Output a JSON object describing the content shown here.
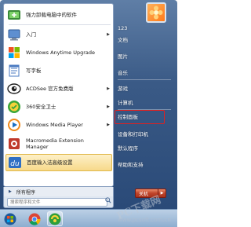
{
  "left_panel": {
    "items": [
      {
        "label": "强力卸载电脑中的软件",
        "icon": "uninstall-icon",
        "arrow": false
      },
      {
        "label": "入门",
        "icon": "getting-started-icon",
        "arrow": true
      },
      {
        "label": "Windows Anytime Upgrade",
        "icon": "windows-upgrade-icon",
        "arrow": false
      },
      {
        "label": "写字板",
        "icon": "wordpad-icon",
        "arrow": false
      },
      {
        "label": "ACDSee 官方免费版",
        "icon": "acdsee-icon",
        "arrow": true
      },
      {
        "label": "360安全卫士",
        "icon": "360-safe-icon",
        "arrow": true
      },
      {
        "label": "Windows Media Player",
        "icon": "media-player-icon",
        "arrow": true
      },
      {
        "label": "Macromedia Extension Manager",
        "icon": "extension-manager-icon",
        "arrow": false
      },
      {
        "label": "百度输入法高级设置",
        "icon": "baidu-ime-icon",
        "arrow": false
      }
    ],
    "all_programs": "所有程序",
    "search_placeholder": "搜索程序和文件"
  },
  "right_panel": {
    "items": [
      "123",
      "文档",
      "图片",
      "音乐",
      "游戏",
      "计算机",
      "控制面板",
      "设备和打印机",
      "默认程序",
      "帮助和支持"
    ],
    "shutdown_label": "关机",
    "dropdown_glyph": "▶"
  },
  "taskbar": {
    "items": [
      "start-orb-icon",
      "chrome-icon",
      "360-browser-icon"
    ]
  },
  "watermark": {
    "text": "PC下载网",
    "url": "www.pcsoft.com.cn"
  },
  "colors": {
    "highlight_border": "#e0b84a",
    "red_frame": "#e02020",
    "menu_blue": "#2a4a78"
  }
}
